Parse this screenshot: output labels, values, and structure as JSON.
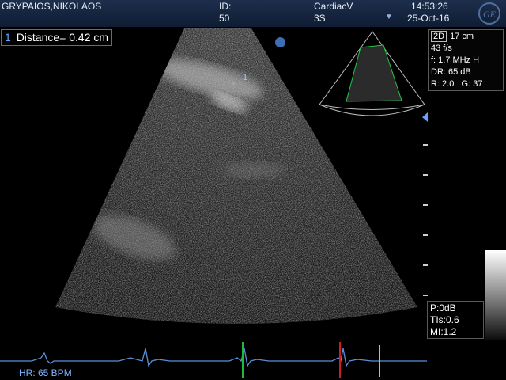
{
  "header": {
    "patient_name": "GRYPAIOS,NIKOLAOS",
    "id_label": "ID:",
    "id_value": "50",
    "preset": "CardiacV",
    "probe": "3S",
    "time": "14:53:26",
    "date": "25-Oct-16"
  },
  "measurement": {
    "index": "1",
    "label": "Distance=",
    "value": "0.42 cm",
    "marker_label": "1"
  },
  "params": {
    "mode": "2D",
    "depth": "17 cm",
    "frame_rate": "43 f/s",
    "frequency": "f: 1.7 MHz H",
    "dynamic_range": "DR: 65 dB",
    "reject": "R: 2.0",
    "gain": "G: 37"
  },
  "power": {
    "p": "P:0dB",
    "tis": "TIs:0.6",
    "mi": "MI:1.2"
  },
  "ecg": {
    "heart_rate": "HR: 65 BPM"
  },
  "colors": {
    "header": "#15243f",
    "ecg_trace": "#5b8fd6",
    "marker_green": "#1dbb3c",
    "marker_red": "#cc2020",
    "marker_tan": "#c9b98a",
    "measure_blue": "#7fb4ff"
  }
}
